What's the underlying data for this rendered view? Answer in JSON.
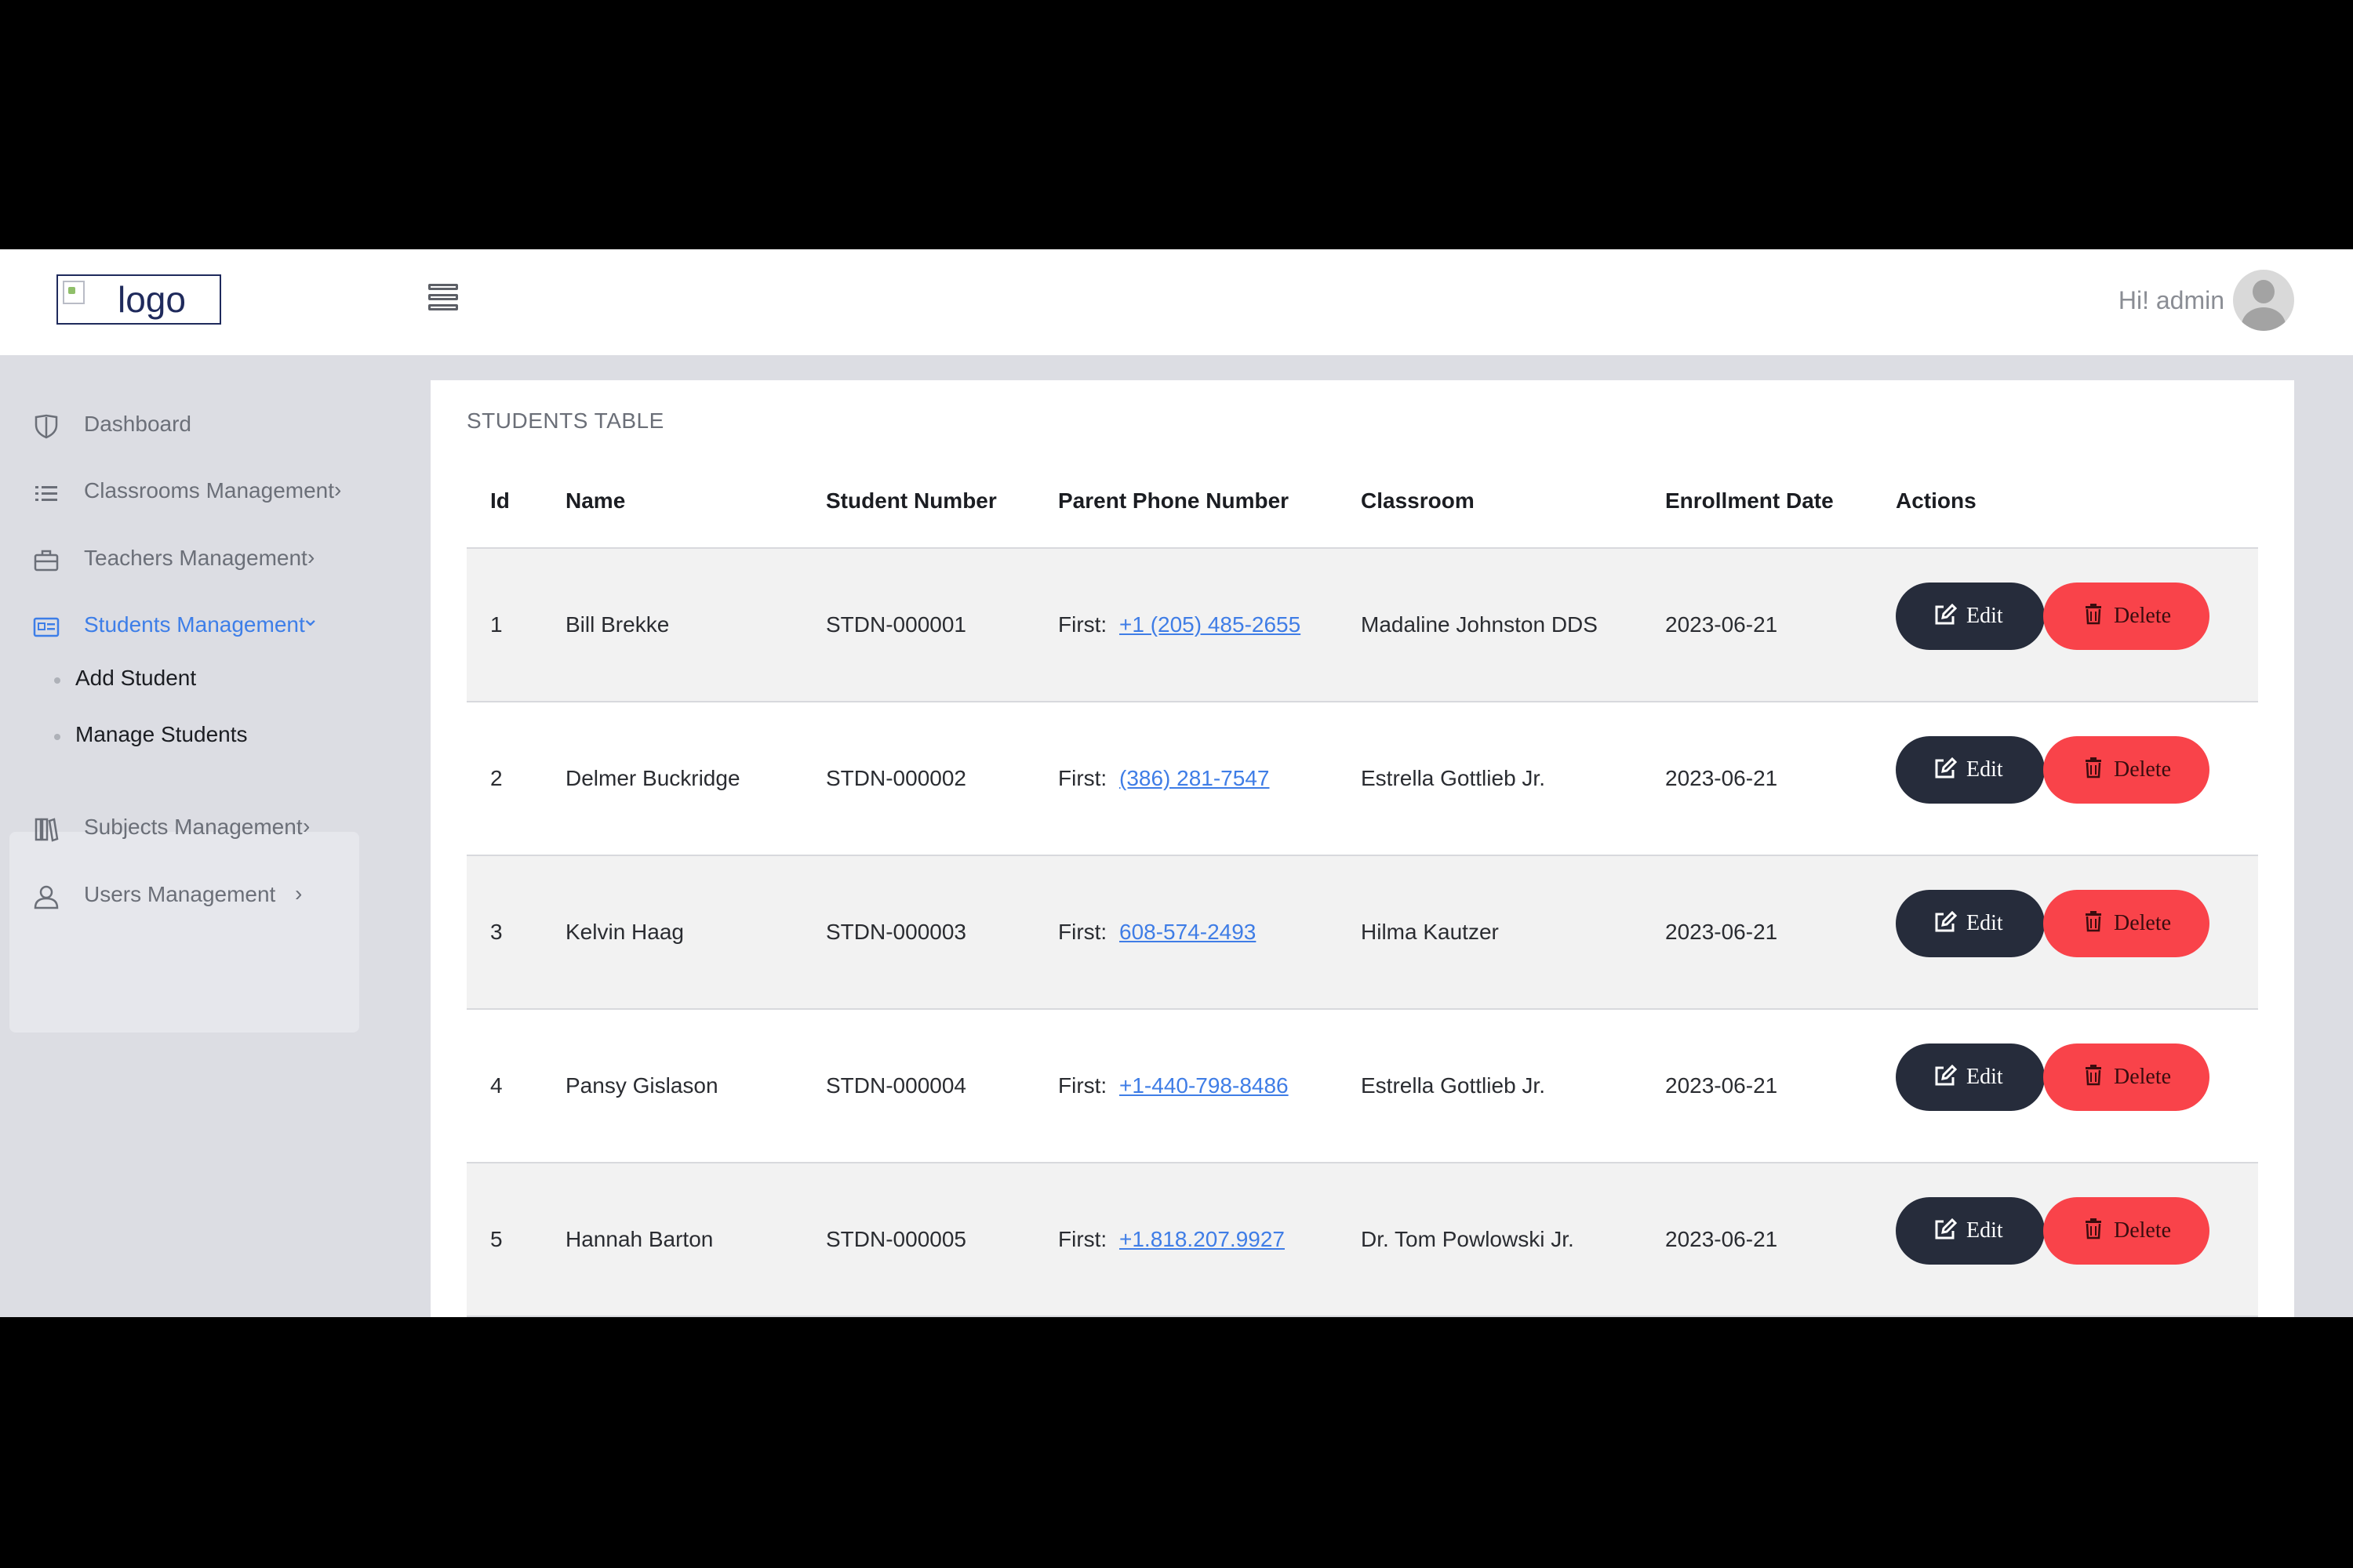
{
  "header": {
    "logo_alt": "logo",
    "greeting": "Hi! admin",
    "menu_icon": "hamburger-icon",
    "avatar_icon": "user-avatar-icon"
  },
  "sidebar": {
    "items": [
      {
        "label": "Dashboard",
        "icon": "shield-icon"
      },
      {
        "label": "Classrooms Management",
        "icon": "list-icon"
      },
      {
        "label": "Teachers Management",
        "icon": "briefcase-icon"
      },
      {
        "label": "Students Management",
        "icon": "id-card-icon"
      },
      {
        "label": "Subjects Management",
        "icon": "books-icon"
      },
      {
        "label": "Users Management",
        "icon": "user-icon"
      }
    ],
    "students_sub": [
      {
        "label": "Add Student"
      },
      {
        "label": "Manage Students"
      }
    ],
    "chevron_right": "›",
    "chevron_down": "⌄"
  },
  "table": {
    "title": "STUDENTS TABLE",
    "headers": {
      "id": "Id",
      "name": "Name",
      "student_number": "Student Number",
      "parent_phone": "Parent Phone Number",
      "classroom": "Classroom",
      "enrollment_date": "Enrollment Date",
      "actions": "Actions"
    },
    "phone_prefix": "First:",
    "edit_label": "Edit",
    "delete_label": "Delete",
    "rows": [
      {
        "id": "1",
        "name": "Bill Brekke",
        "student_number": "STDN-000001",
        "phone": "+1 (205) 485-2655",
        "classroom": "Madaline Johnston DDS",
        "date": "2023-06-21"
      },
      {
        "id": "2",
        "name": "Delmer Buckridge",
        "student_number": "STDN-000002",
        "phone": "(386) 281-7547",
        "classroom": "Estrella Gottlieb Jr.",
        "date": "2023-06-21"
      },
      {
        "id": "3",
        "name": "Kelvin Haag",
        "student_number": "STDN-000003",
        "phone": "608-574-2493",
        "classroom": "Hilma Kautzer",
        "date": "2023-06-21"
      },
      {
        "id": "4",
        "name": "Pansy Gislason",
        "student_number": "STDN-000004",
        "phone": "+1-440-798-8486",
        "classroom": "Estrella Gottlieb Jr.",
        "date": "2023-06-21"
      },
      {
        "id": "5",
        "name": "Hannah Barton",
        "student_number": "STDN-000005",
        "phone": "+1.818.207.9927",
        "classroom": "Dr. Tom Powlowski Jr.",
        "date": "2023-06-21"
      }
    ]
  },
  "colors": {
    "accent": "#3d7ee8",
    "edit_button": "#262c3b",
    "delete_button": "#f9434a"
  }
}
